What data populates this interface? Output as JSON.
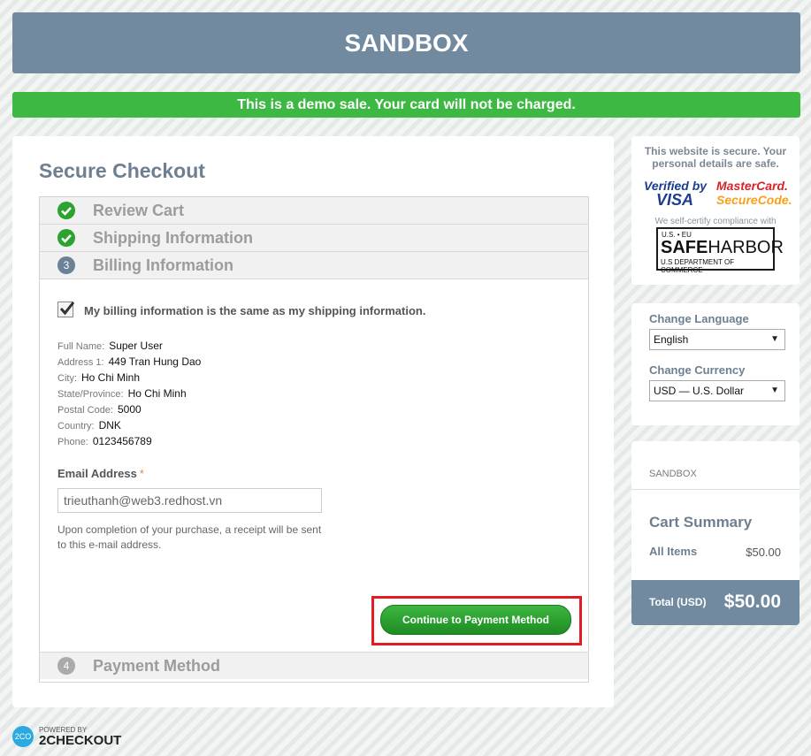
{
  "banner": {
    "title": "SANDBOX"
  },
  "demo_notice": "This is a demo sale. Your card will not be charged.",
  "checkout": {
    "title": "Secure Checkout",
    "steps": [
      {
        "label": "Review Cart",
        "status": "complete"
      },
      {
        "label": "Shipping Information",
        "status": "complete"
      },
      {
        "number": "3",
        "label": "Billing Information",
        "status": "active"
      },
      {
        "number": "4",
        "label": "Payment Method",
        "status": "pending"
      }
    ],
    "same_as_shipping": {
      "label": "My billing information is the same as my shipping information.",
      "checked": true
    },
    "address": [
      {
        "label": "Full Name:",
        "value": "Super User"
      },
      {
        "label": "Address 1:",
        "value": "449 Tran Hung Dao"
      },
      {
        "label": "City:",
        "value": "Ho Chi Minh"
      },
      {
        "label": "State/Province:",
        "value": "Ho Chi Minh"
      },
      {
        "label": "Postal Code:",
        "value": "5000"
      },
      {
        "label": "Country:",
        "value": "DNK"
      },
      {
        "label": "Phone:",
        "value": "0123456789"
      }
    ],
    "email": {
      "label": "Email Address",
      "required_mark": "*",
      "value": "trieuthanh@web3.redhost.vn"
    },
    "receipt_note": "Upon completion of your purchase, a receipt will be sent to this e-mail address.",
    "continue_label": "Continue to Payment Method"
  },
  "security": {
    "text": "This website is secure. Your personal details are safe.",
    "vbv_line1": "Verified by",
    "vbv_line2": "VISA",
    "msc_line1": "MasterCard.",
    "msc_line2": "SecureCode.",
    "self_certify": "We self-certify compliance with",
    "safeharbor_top": "U.S. • EU",
    "safeharbor_safe": "SAFE",
    "safeharbor_harbor": "HARBOR",
    "safeharbor_bottom": "U.S DEPARTMENT OF COMMERCE"
  },
  "preferences": {
    "language_label": "Change Language",
    "language_value": "English",
    "currency_label": "Change Currency",
    "currency_value": "USD — U.S. Dollar",
    "arrow": "▼"
  },
  "cart": {
    "vendor": "SANDBOX",
    "title": "Cart Summary",
    "items_label": "All Items",
    "items_value": "$50.00",
    "total_label": "Total (USD)",
    "total_value": "$50.00"
  },
  "footer": {
    "logo": "2CO",
    "powered_by": "POWERED BY",
    "brand": "2CHECKOUT"
  },
  "colors": {
    "header": "#718aa0",
    "demo": "#3db842",
    "continue": "#2ca32f",
    "highlight": "#e31b23"
  }
}
